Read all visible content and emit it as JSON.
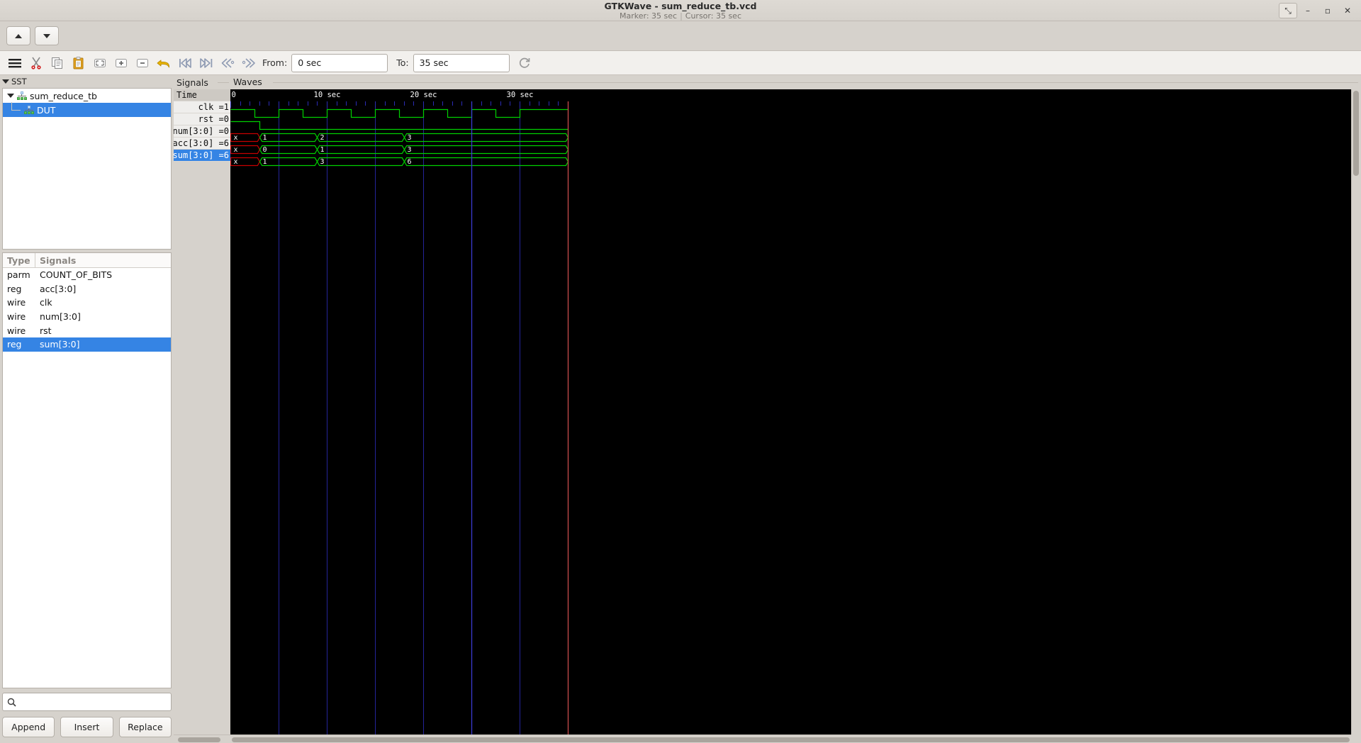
{
  "window": {
    "title": "GTKWave - sum_reduce_tb.vcd",
    "marker": "Marker: 35 sec",
    "separator": "|",
    "cursor": "Cursor: 35 sec",
    "buttons": {
      "fullscreen": "⤡",
      "minimize": "–",
      "maximize": "▫",
      "close": "✕"
    }
  },
  "navrow": {
    "up": "up-arrow",
    "down": "down-arrow"
  },
  "toolbar": {
    "icons": [
      "menu-icon",
      "cut-icon",
      "copy-icon",
      "paste-icon",
      "zoom-fit-icon",
      "zoom-in-icon",
      "zoom-out-icon",
      "undo-icon",
      "goto-start-icon",
      "goto-end-icon",
      "prev-edge-icon",
      "next-edge-icon"
    ],
    "from_label": "From:",
    "from_value": "0 sec",
    "to_label": "To:",
    "to_value": "35 sec",
    "reload_icon": "reload-icon"
  },
  "sst": {
    "header": "SST",
    "tree": [
      {
        "label": "sum_reduce_tb",
        "depth": 0,
        "expanded": true,
        "selected": false
      },
      {
        "label": "DUT",
        "depth": 1,
        "expanded": false,
        "selected": true
      }
    ]
  },
  "signal_table": {
    "columns": [
      "Type",
      "Signals"
    ],
    "rows": [
      {
        "type": "parm",
        "name": "COUNT_OF_BITS",
        "selected": false
      },
      {
        "type": "reg",
        "name": "acc[3:0]",
        "selected": false
      },
      {
        "type": "wire",
        "name": "clk",
        "selected": false
      },
      {
        "type": "wire",
        "name": "num[3:0]",
        "selected": false
      },
      {
        "type": "wire",
        "name": "rst",
        "selected": false
      },
      {
        "type": "reg",
        "name": "sum[3:0]",
        "selected": true
      }
    ]
  },
  "search": {
    "placeholder": "",
    "value": "",
    "icon": "search-icon"
  },
  "action_buttons": [
    {
      "label": "Append"
    },
    {
      "label": "Insert"
    },
    {
      "label": "Replace"
    }
  ],
  "signals_panel": {
    "title": "Signals",
    "time_label": "Time",
    "rows": [
      {
        "label": "clk =1",
        "selected": false
      },
      {
        "label": "rst =0",
        "selected": false
      },
      {
        "label": "num[3:0] =0",
        "selected": false
      },
      {
        "label": "acc[3:0] =6",
        "selected": false
      },
      {
        "label": "sum[3:0] =6",
        "selected": true
      }
    ]
  },
  "waves_panel": {
    "title": "Waves",
    "time_axis": {
      "origin_label": "0",
      "ticks": [
        {
          "label": "10 sec",
          "time": 10
        },
        {
          "label": "20 sec",
          "time": 20
        },
        {
          "label": "30 sec",
          "time": 30
        }
      ],
      "minor_tick_interval": 1,
      "range_start": 0,
      "range_end": 35
    },
    "colors": {
      "background": "#000000",
      "trace": "#00d000",
      "unknown": "#c80000",
      "grid": "#2b2bb4",
      "marker": "#c84c4c",
      "text": "#ffffff"
    },
    "signals": [
      {
        "name": "clk",
        "type": "binary",
        "transitions": [
          {
            "time": 0,
            "value": "1"
          },
          {
            "time": 2.5,
            "value": "0"
          },
          {
            "time": 5,
            "value": "1"
          },
          {
            "time": 7.5,
            "value": "0"
          },
          {
            "time": 10,
            "value": "1"
          },
          {
            "time": 12.5,
            "value": "0"
          },
          {
            "time": 15,
            "value": "1"
          },
          {
            "time": 17.5,
            "value": "0"
          },
          {
            "time": 20,
            "value": "1"
          },
          {
            "time": 22.5,
            "value": "0"
          },
          {
            "time": 25,
            "value": "1"
          },
          {
            "time": 27.5,
            "value": "0"
          },
          {
            "time": 30,
            "value": "1"
          }
        ]
      },
      {
        "name": "rst",
        "type": "binary",
        "transitions": [
          {
            "time": 0,
            "value": "1"
          },
          {
            "time": 3,
            "value": "0"
          }
        ]
      },
      {
        "name": "num[3:0]",
        "type": "bus",
        "segments": [
          {
            "start": 0,
            "end": 3,
            "value": "x",
            "unknown": true
          },
          {
            "start": 3,
            "end": 9,
            "value": "1",
            "unknown": false
          },
          {
            "start": 9,
            "end": 18,
            "value": "2",
            "unknown": false
          },
          {
            "start": 18,
            "end": 35,
            "value": "3",
            "unknown": false
          }
        ]
      },
      {
        "name": "acc[3:0]",
        "type": "bus",
        "segments": [
          {
            "start": 0,
            "end": 3,
            "value": "x",
            "unknown": true
          },
          {
            "start": 3,
            "end": 9,
            "value": "0",
            "unknown": false
          },
          {
            "start": 9,
            "end": 18,
            "value": "1",
            "unknown": false
          },
          {
            "start": 18,
            "end": 35,
            "value": "3",
            "unknown": false
          }
        ]
      },
      {
        "name": "sum[3:0]",
        "type": "bus",
        "segments": [
          {
            "start": 0,
            "end": 3,
            "value": "x",
            "unknown": true
          },
          {
            "start": 3,
            "end": 9,
            "value": "1",
            "unknown": false
          },
          {
            "start": 9,
            "end": 18,
            "value": "3",
            "unknown": false
          },
          {
            "start": 18,
            "end": 35,
            "value": "6",
            "unknown": false
          }
        ]
      }
    ],
    "markers": [
      {
        "name": "cursor",
        "time": 35,
        "color": "#c84c4c"
      },
      {
        "name": "grid-25",
        "time": 25,
        "color": "#3a3ad0"
      }
    ]
  }
}
